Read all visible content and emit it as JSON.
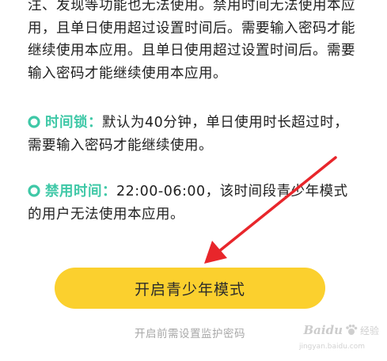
{
  "intro": {
    "text": "注、发现等功能也无法使用。禁用时间无法使用本应用，且单日使用超过设置时间后。需要输入密码才能继续使用本应用。且单日使用超过设置时间后。需要输入密码才能继续使用本应用。"
  },
  "time_lock": {
    "label": "时间锁：",
    "text": "默认为40分钟，单日使用时长超过时，需要输入密码才能继续使用。"
  },
  "ban_time": {
    "label": "禁用时间：",
    "text": "22:00-06:00，该时间段青少年模式的用户无法使用本应用。"
  },
  "cta": {
    "label": "开启青少年模式"
  },
  "hint": {
    "text": "开启前需设置监护密码"
  },
  "watermark": {
    "brand": "Baidu",
    "sub": "经验",
    "url": "jingyan.baidu.com"
  },
  "colors": {
    "accent": "#3fc8a7",
    "button": "#fbd02e",
    "arrow": "#e8262b"
  },
  "icons": {
    "bullet": "ring-bullet-icon",
    "arrow": "red-arrow-annotation"
  }
}
